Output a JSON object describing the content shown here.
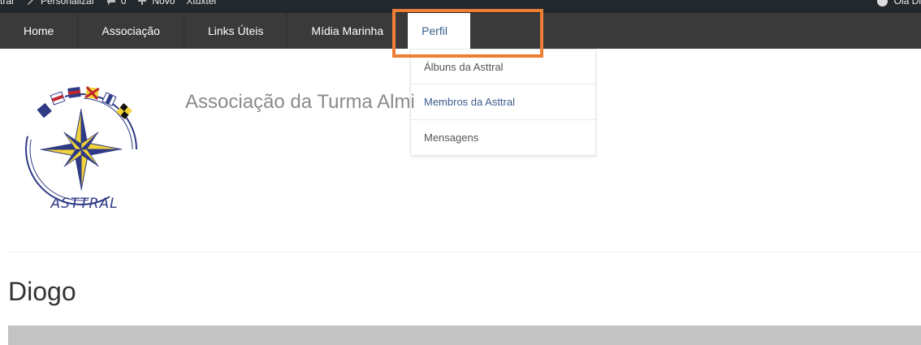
{
  "adminbar": {
    "left_cut": "trar",
    "customize_label": "Personalizar",
    "comments_count": "0",
    "new_label": "Novo",
    "edit_label": "Xtuxtei",
    "greeting": "Olá Di"
  },
  "nav": {
    "items": [
      {
        "label": "Home"
      },
      {
        "label": "Associação"
      },
      {
        "label": "Links Úteis"
      },
      {
        "label": "Mídia Marinha"
      },
      {
        "label": "Perfil"
      }
    ]
  },
  "dropdown": {
    "items": [
      {
        "label": "Álbuns da Asttral"
      },
      {
        "label": "Membros da Asttral"
      },
      {
        "label": "Mensagens"
      }
    ]
  },
  "site": {
    "title": "Associação da Turma Almi",
    "logo_text": "ASTTRAL"
  },
  "page": {
    "title": "Diogo"
  },
  "colors": {
    "nav_bg": "#3a3a3a",
    "highlight": "#ef7e35",
    "link": "#3b5c8f",
    "logo_blue": "#2e3a85",
    "logo_yellow": "#f2d338"
  }
}
